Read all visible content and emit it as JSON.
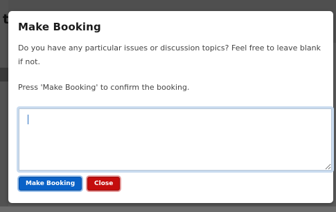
{
  "backdrop": {
    "peek_text": "t"
  },
  "modal": {
    "title": "Make Booking",
    "description": "Do you have any particular issues or discussion topics? Feel free to leave blank if not.",
    "confirm_text": "Press 'Make Booking' to confirm the booking.",
    "textarea_value": "",
    "primary_button_label": "Make Booking",
    "close_button_label": "Close"
  },
  "colors": {
    "primary": "#0a62c7",
    "danger": "#c40d0d",
    "focus_ring": "#c9dbef"
  }
}
